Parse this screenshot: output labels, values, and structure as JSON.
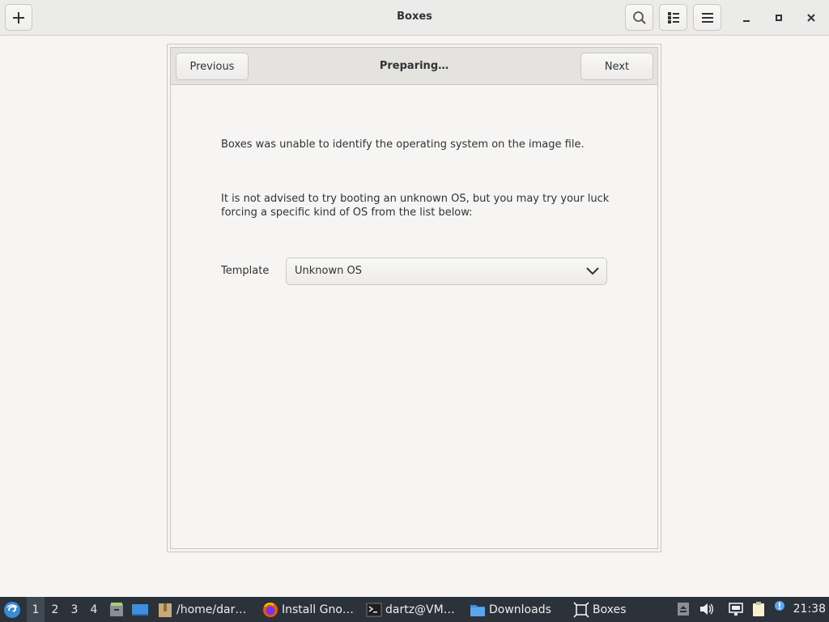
{
  "window": {
    "title": "Boxes",
    "buttons": {
      "new": "new-icon",
      "search": "search-icon",
      "view": "list-view-icon",
      "menu": "hamburger-menu-icon",
      "minimize": "minimize-icon",
      "maximize": "maximize-icon",
      "close": "close-icon"
    }
  },
  "assistant": {
    "page_title": "Preparing…",
    "previous_label": "Previous",
    "next_label": "Next",
    "message_1": "Boxes was unable to identify the operating system on the image file.",
    "message_2": "It is not advised to try booting an unknown OS, but you may try your luck forcing a specific kind of OS from the list below:",
    "template_label": "Template",
    "template_value": "Unknown OS"
  },
  "taskbar": {
    "workspaces": [
      "1",
      "2",
      "3",
      "4"
    ],
    "active_workspace": "1",
    "tasks": [
      {
        "label": "/home/dar…",
        "icon": "folder-archive-icon"
      },
      {
        "label": "Install Gno…",
        "icon": "firefox-icon"
      },
      {
        "label": "dartz@VM…",
        "icon": "terminal-icon"
      },
      {
        "label": "Downloads",
        "icon": "folder-icon"
      },
      {
        "label": "Boxes",
        "icon": "boxes-icon"
      }
    ],
    "clock": "21:38"
  },
  "colors": {
    "window_bg": "#f6f5f4",
    "headerbar_bg": "#ebebea",
    "taskbar_bg": "#2b323a",
    "text": "#2e3436"
  }
}
